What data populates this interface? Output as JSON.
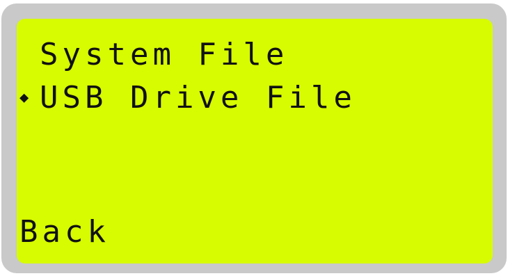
{
  "menu": {
    "items": [
      {
        "label": "System File",
        "selected": false
      },
      {
        "label": "USB Drive File",
        "selected": true
      }
    ],
    "selection_marker": "◆",
    "back_label": "Back"
  },
  "colors": {
    "screen_background": "#d7fb00",
    "bezel": "#c9c9c9",
    "text": "#111111"
  }
}
